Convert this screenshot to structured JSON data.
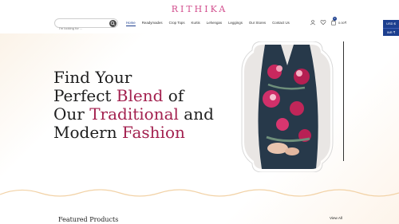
{
  "brand": {
    "name": "RITHIKA",
    "color": "#d24d8d"
  },
  "search": {
    "placeholder": "I'm looking for ...",
    "value": ""
  },
  "nav": {
    "items": [
      {
        "label": "Home",
        "active": true
      },
      {
        "label": "Readymades",
        "active": false
      },
      {
        "label": "Crop Tops",
        "active": false
      },
      {
        "label": "Kurtis",
        "active": false
      },
      {
        "label": "Lehengas",
        "active": false
      },
      {
        "label": "Leggings",
        "active": false
      },
      {
        "label": "Our Stores",
        "active": false
      },
      {
        "label": "Contact Us",
        "active": false
      }
    ],
    "active_color": "#1d3f8f"
  },
  "header_icons": {
    "account": "user-icon",
    "wishlist": "heart-icon",
    "cart": "bag-icon"
  },
  "cart": {
    "count": "0",
    "total": "0.00₹"
  },
  "currency": {
    "options": [
      "USD $",
      "INR ₹"
    ]
  },
  "hero": {
    "line1": "Find Your",
    "line2_a": "Perfect ",
    "line2_b": "Blend",
    "line2_c": " of",
    "line3_a": "Our ",
    "line3_b": "Traditional",
    "line3_c": " and",
    "line4_a": "Modern ",
    "line4_b": "Fashion",
    "accent_color": "#a3214f"
  },
  "featured": {
    "title": "Featured Products",
    "view_all": "View All"
  }
}
